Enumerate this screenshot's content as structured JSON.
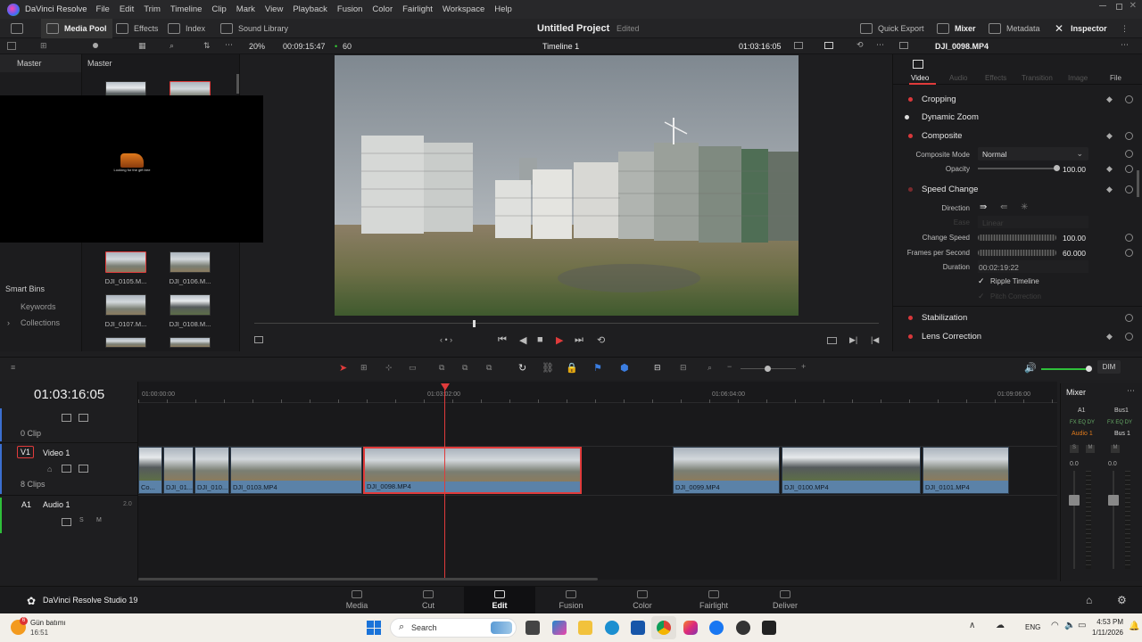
{
  "menubar": {
    "app_name": "DaVinci Resolve",
    "items": [
      "File",
      "Edit",
      "Trim",
      "Timeline",
      "Clip",
      "Mark",
      "View",
      "Playback",
      "Fusion",
      "Color",
      "Fairlight",
      "Workspace",
      "Help"
    ]
  },
  "toolbar": {
    "media_pool": "Media Pool",
    "effects": "Effects",
    "index": "Index",
    "sound_library": "Sound Library",
    "project_title": "Untitled Project",
    "project_status": "Edited",
    "quick_export": "Quick Export",
    "mixer": "Mixer",
    "metadata": "Metadata",
    "inspector": "Inspector"
  },
  "subbar": {
    "zoom": "20%",
    "source_tc": "00:09:15:47",
    "fps": "60",
    "timeline_name": "Timeline 1",
    "record_tc": "01:03:16:05",
    "clip_name": "DJI_0098.MP4"
  },
  "left_panel": {
    "master": "Master",
    "smart_bins": "Smart Bins",
    "keywords": "Keywords",
    "collections": "Collections"
  },
  "media_pool": {
    "bin_title": "Master",
    "clips": [
      {
        "name": "DJI_0105.M..."
      },
      {
        "name": "DJI_0106.M..."
      },
      {
        "name": "DJI_0107.M..."
      },
      {
        "name": "DJI_0108.M..."
      }
    ]
  },
  "inspector": {
    "tabs": [
      "Video",
      "Audio",
      "Effects",
      "Transition",
      "Image",
      "File"
    ],
    "sections": {
      "cropping": "Cropping",
      "dynamic_zoom": "Dynamic Zoom",
      "composite": "Composite",
      "composite_mode_label": "Composite Mode",
      "composite_mode_value": "Normal",
      "opacity_label": "Opacity",
      "opacity_value": "100.00",
      "speed_change": "Speed Change",
      "direction_label": "Direction",
      "ease_label": "Ease",
      "ease_value": "Linear",
      "change_speed_label": "Change Speed",
      "change_speed_value": "100.00",
      "fps_label": "Frames per Second",
      "fps_value": "60.000",
      "duration_label": "Duration",
      "duration_value": "00:02:19:22",
      "ripple_label": "Ripple Timeline",
      "pitch_label": "Pitch Correction",
      "stabilization": "Stabilization",
      "lens_correction": "Lens Correction"
    }
  },
  "timeline": {
    "timecode": "01:03:16:05",
    "ruler": [
      "01:00:00:00",
      "01:03:02:00",
      "01:06:04:00",
      "01:09:06:00"
    ],
    "track_empty_clips": "0 Clip",
    "video_track_id": "V1",
    "video_track_name": "Video 1",
    "video_clips_count": "8 Clips",
    "audio_track_id": "A1",
    "audio_track_name": "Audio 1",
    "audio_track_level": "2.0",
    "dim": "DIM",
    "clips": [
      {
        "name": "Co..."
      },
      {
        "name": "DJI_01..."
      },
      {
        "name": "DJI_010..."
      },
      {
        "name": "DJI_0103.MP4"
      },
      {
        "name": "DJI_0098.MP4"
      },
      {
        "name": "DJI_0099.MP4"
      },
      {
        "name": "DJI_0100.MP4"
      },
      {
        "name": "DJI_0101.MP4"
      }
    ]
  },
  "mixer": {
    "title": "Mixer",
    "a1": "A1",
    "bus1": "Bus1",
    "audio1": "Audio 1",
    "bus1_out": "Bus 1",
    "level_left": "0.0",
    "level_right": "0.0"
  },
  "pages": {
    "version": "DaVinci Resolve Studio 19",
    "items": [
      "Media",
      "Cut",
      "Edit",
      "Fusion",
      "Color",
      "Fairlight",
      "Deliver"
    ],
    "active": "Edit"
  },
  "taskbar": {
    "weather_title": "Gün batımı",
    "weather_time": "16:51",
    "badge": "6",
    "search": "Search",
    "lang": "ENG",
    "time": "4:53 PM",
    "date": "1/11/2026"
  },
  "overlay_caption": "Looking for the gift tree"
}
